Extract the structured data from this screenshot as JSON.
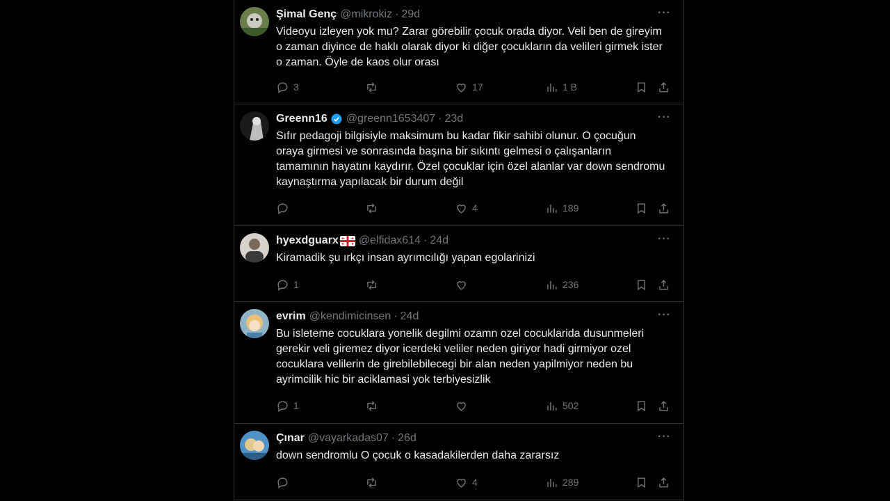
{
  "tweets": [
    {
      "name": "Şimal Genç",
      "handle": "@mikrokiz",
      "time": "29d",
      "text": "Videoyu izleyen yok mu? Zarar görebilir çocuk orada diyor. Veli ben de gireyim o zaman diyince de haklı olarak diyor ki diğer çocukların da velileri girmek ister o zaman. Öyle de kaos olur orası",
      "replies": "3",
      "retweets": "",
      "likes": "17",
      "views": "1 B",
      "avatar_colors": [
        "#6b7d4a",
        "#c9cbbf"
      ]
    },
    {
      "name": "Greenn16",
      "handle": "@greenn1653407",
      "time": "23d",
      "text": "Sıfır pedagoji bilgisiyle maksimum bu kadar fikir sahibi olunur. O çocuğun oraya girmesi ve sonrasında başına bir sıkıntı gelmesi o çalışanların tamamının hayatını kaydırır. Özel çocuklar için özel alanlar var down sendromu kaynaştırma yapılacak bir durum değil",
      "replies": "",
      "retweets": "",
      "likes": "4",
      "views": "189",
      "avatar_colors": [
        "#1a1a1a",
        "#bdbdbd"
      ]
    },
    {
      "name": "hyexdguarx",
      "handle": "@elfidax614",
      "time": "24d",
      "text": "Kiramadik şu ırkçı insan ayrımcılığı yapan egolarinizi",
      "replies": "1",
      "retweets": "",
      "likes": "",
      "views": "236",
      "avatar_colors": [
        "#7a6a5c",
        "#d8d2cc"
      ]
    },
    {
      "name": "evrim",
      "handle": "@kendimicinsen",
      "time": "24d",
      "text": "Bu isletеme cocuklara yonelik degilmi ozamn ozel cocuklarida dusunmeleri gerekir veli giremez diyor icerdeki veliler neden giriyor hadi girmiyor ozel cocuklara velilerin de girebilebilecegi bir alan neden yapilmiyor neden bu ayrimcilik hic bir aciklamasi yok  terbiyesizlik",
      "replies": "1",
      "retweets": "",
      "likes": "",
      "views": "502",
      "avatar_colors": [
        "#8fb3c7",
        "#e8c27a"
      ]
    },
    {
      "name": "Çınar",
      "handle": "@vayarkadas07",
      "time": "26d",
      "text": "down sendromlu O çocuk o kasadakilerden daha zararsız",
      "replies": "",
      "retweets": "",
      "likes": "4",
      "views": "289",
      "avatar_colors": [
        "#4f93c9",
        "#e3c88f"
      ]
    }
  ],
  "ui": {
    "more_label": "···",
    "dot": "·",
    "accent": "#1d9bf0"
  }
}
